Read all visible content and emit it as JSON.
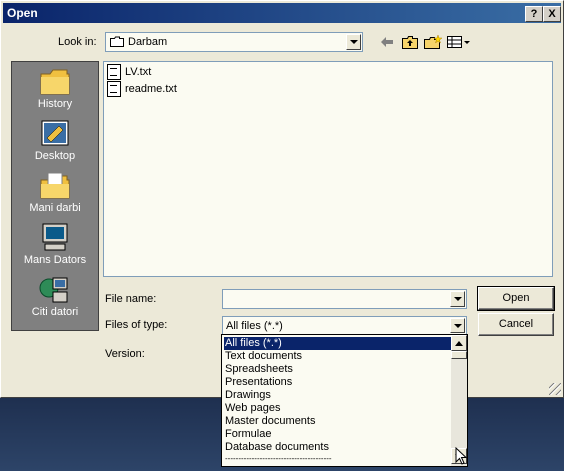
{
  "window": {
    "title": "Open",
    "help_label": "?",
    "close_label": "X"
  },
  "toolbar": {
    "look_in_label": "Look in:",
    "look_in_value": "Darbam"
  },
  "places": [
    {
      "label": "History",
      "icon": "history-folder-icon"
    },
    {
      "label": "Desktop",
      "icon": "desktop-icon"
    },
    {
      "label": "Mani darbi",
      "icon": "my-documents-folder-icon"
    },
    {
      "label": "Mans Dators",
      "icon": "my-computer-icon"
    },
    {
      "label": "Citi datori",
      "icon": "network-computers-icon"
    }
  ],
  "files": [
    {
      "name": "LV.txt",
      "icon": "text-file-icon"
    },
    {
      "name": "readme.txt",
      "icon": "text-file-icon"
    }
  ],
  "form": {
    "file_name_label": "File name:",
    "file_name_value": "",
    "files_of_type_label": "Files of type:",
    "files_of_type_value": "All files (*.*)",
    "version_label": "Version:"
  },
  "buttons": {
    "open": "Open",
    "cancel": "Cancel"
  },
  "type_options": [
    "All files (*.*)",
    "Text documents",
    "Spreadsheets",
    "Presentations",
    "Drawings",
    "Web pages",
    "Master documents",
    "Formulae",
    "Database documents",
    "----------------------------------------"
  ],
  "selected_option_index": 0
}
